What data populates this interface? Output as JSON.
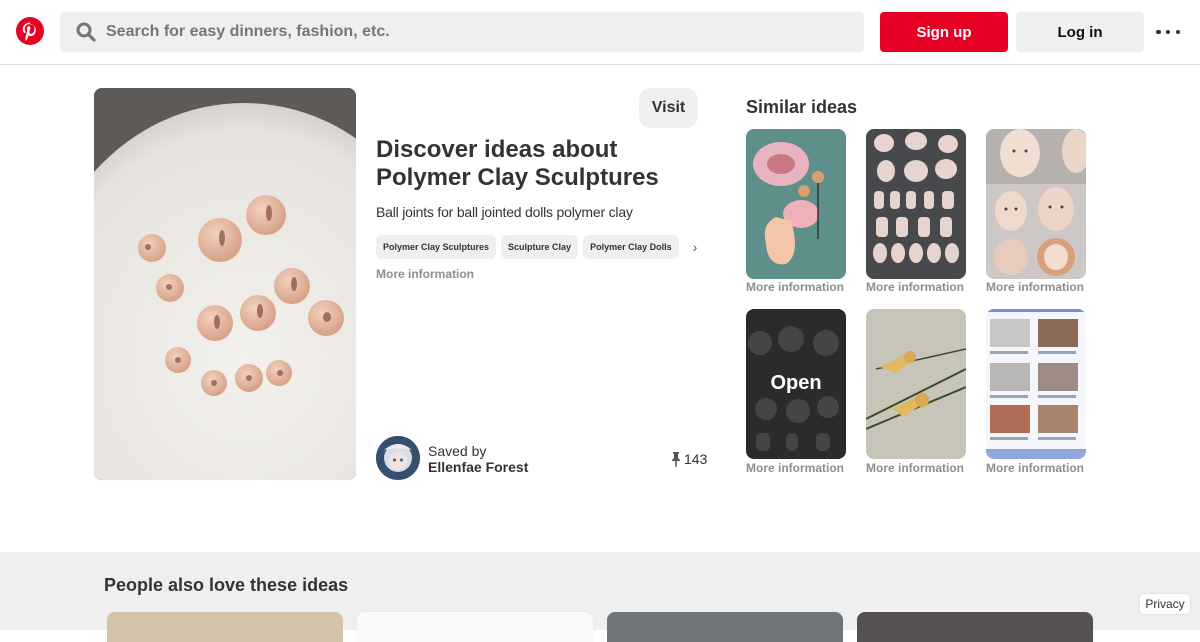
{
  "header": {
    "search_placeholder": "Search for easy dinners, fashion, etc.",
    "signup_label": "Sign up",
    "login_label": "Log in",
    "brand_color": "#e60023"
  },
  "pin": {
    "visit_label": "Visit",
    "title": "Discover ideas about Polymer Clay Sculptures",
    "description": "Ball joints for ball jointed dolls polymer clay",
    "tags": [
      "Polymer Clay Sculptures",
      "Sculpture Clay",
      "Polymer Clay Dolls"
    ],
    "more_info": "More information",
    "saved_by_label": "Saved by",
    "saver_name": "Ellenfae Forest",
    "repin_count": "143"
  },
  "similar": {
    "title": "Similar ideas",
    "items": [
      {
        "info": "More information"
      },
      {
        "info": "More information"
      },
      {
        "info": "More information"
      },
      {
        "info": "More information",
        "overlay": "Open"
      },
      {
        "info": "More information"
      },
      {
        "info": "More information"
      }
    ]
  },
  "bottom": {
    "title": "People also love these ideas"
  },
  "footer": {
    "privacy_label": "Privacy"
  }
}
